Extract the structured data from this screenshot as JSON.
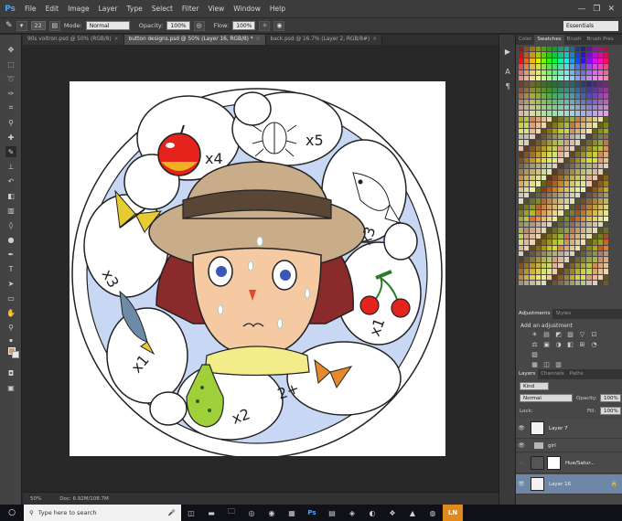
{
  "app": {
    "logo": "Ps"
  },
  "menu": [
    "File",
    "Edit",
    "Image",
    "Layer",
    "Type",
    "Select",
    "Filter",
    "View",
    "Window",
    "Help"
  ],
  "window_controls": [
    "—",
    "❐",
    "✕"
  ],
  "options_bar": {
    "brush_size": "22",
    "mode_label": "Mode:",
    "mode_value": "Normal",
    "opacity_label": "Opacity:",
    "opacity_value": "100%",
    "flow_label": "Flow:",
    "flow_value": "100%",
    "workspace": "Essentials"
  },
  "tabs": [
    {
      "label": "90s voltron.psd @ 50% (RGB/8)"
    },
    {
      "label": "button designs.psd @ 50% (Layer 16, RGB/8) *"
    },
    {
      "label": "back.psd @ 16.7% (Layer 2, RGB/8#)"
    }
  ],
  "status": {
    "zoom": "50%",
    "doc": "Doc: 6.92M/108.7M"
  },
  "artwork": {
    "labels": [
      "x4",
      "x5",
      "x3",
      "x1",
      "x1",
      "x2",
      "2+",
      "x3"
    ]
  },
  "swatch_panel": {
    "tabs": [
      "Color",
      "Swatches",
      "Brush",
      "Brush Pres"
    ],
    "active": 1
  },
  "adjustments_panel": {
    "tabs": [
      "Adjustments",
      "Styles"
    ],
    "title": "Add an adjustment",
    "icons": [
      "☀",
      "▤",
      "◩",
      "▧",
      "▽",
      "⊡",
      "⚖",
      "▣",
      "◑",
      "◧",
      "⊞",
      "◔",
      "▨",
      "▦",
      "◫",
      "▥"
    ]
  },
  "layers_panel": {
    "tabs": [
      "Layers",
      "Channels",
      "Paths"
    ],
    "kind": "Kind",
    "blend": "Normal",
    "opacity_label": "Opacity:",
    "opacity": "100%",
    "lock_label": "Lock:",
    "fill_label": "Fill:",
    "fill": "100%",
    "layers": [
      {
        "name": "Layer 7",
        "type": "layer",
        "visible": true,
        "selected": false
      },
      {
        "name": "girl",
        "type": "group",
        "visible": true,
        "selected": false
      },
      {
        "name": "Hue/Satur...",
        "type": "adjustment",
        "visible": false,
        "selected": false
      },
      {
        "name": "Layer 16",
        "type": "layer",
        "visible": true,
        "selected": true
      }
    ]
  },
  "taskbar": {
    "search_placeholder": "Type here to search",
    "apps": [
      "◫",
      "▬",
      "🗀",
      "◎",
      "◉",
      "▦",
      "Ps",
      "▤",
      "◈",
      "◐",
      "❖",
      "▲",
      "◍",
      "LN"
    ]
  }
}
